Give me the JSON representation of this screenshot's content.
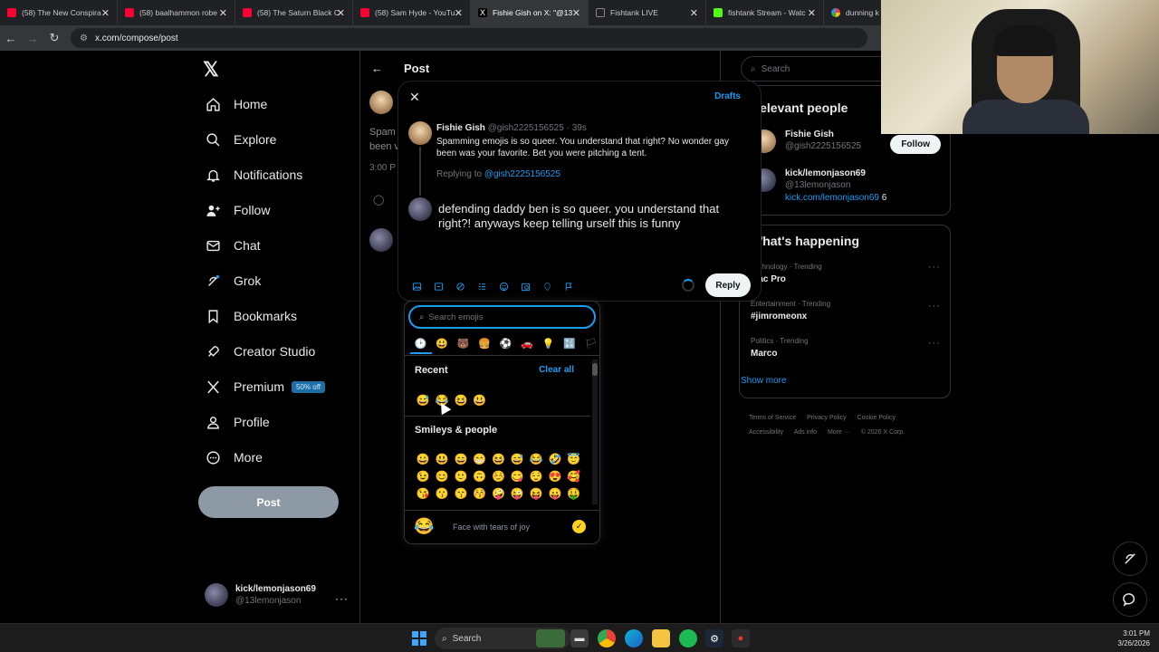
{
  "browser": {
    "tabs": [
      {
        "title": "(58) The New Conspira",
        "icon": "youtube-icon"
      },
      {
        "title": "(58) baalhammon robe",
        "icon": "youtube-icon"
      },
      {
        "title": "(58) The Saturn Black C",
        "icon": "youtube-icon"
      },
      {
        "title": "(58) Sam Hyde - YouTu",
        "icon": "youtube-icon"
      },
      {
        "title": "Fishie Gish on X: \"@13",
        "icon": "x-icon"
      },
      {
        "title": "Fishtank LIVE",
        "icon": "fishtank-icon"
      },
      {
        "title": "fishtank Stream - Watc",
        "icon": "kick-icon"
      },
      {
        "title": "dunning k",
        "icon": "google-icon"
      }
    ],
    "url": "x.com/compose/post"
  },
  "sidebar": {
    "logo": "𝕏",
    "items": [
      {
        "label": "Home",
        "icon": "home-icon"
      },
      {
        "label": "Explore",
        "icon": "search-icon"
      },
      {
        "label": "Notifications",
        "icon": "bell-icon"
      },
      {
        "label": "Follow",
        "icon": "person-add-icon"
      },
      {
        "label": "Chat",
        "icon": "mail-icon"
      },
      {
        "label": "Grok",
        "icon": "grok-icon"
      },
      {
        "label": "Bookmarks",
        "icon": "bookmark-icon"
      },
      {
        "label": "Creator Studio",
        "icon": "rocket-icon"
      },
      {
        "label": "Premium",
        "icon": "x-icon"
      },
      {
        "label": "Profile",
        "icon": "person-icon"
      },
      {
        "label": "More",
        "icon": "more-circle-icon"
      }
    ],
    "premium_badge": "50% off",
    "post_button": "Post",
    "account": {
      "name": "kick/lemonjason69",
      "handle": "@13lemonjason"
    }
  },
  "center": {
    "title": "Post",
    "bg_text": "Spam been v",
    "bg_time": "3:00 P"
  },
  "modal": {
    "close": "✕",
    "drafts": "Drafts",
    "original": {
      "name": "Fishie Gish",
      "handle": "@gish2225156525",
      "time": "· 39s",
      "text": "Spamming emojis is so queer. You understand that right? No wonder gay been was your favorite. Bet you were pitching a tent."
    },
    "replying_prefix": "Replying to",
    "replying_handle": "@gish2225156525",
    "reply_text": "defending daddy ben is so queer. you understand that right?! anyways keep telling urself this is funny",
    "reply_button": "Reply"
  },
  "emoji_picker": {
    "search_placeholder": "Search emojis",
    "categories": [
      "🕑",
      "😃",
      "🐻",
      "🍔",
      "⚽",
      "🚗",
      "💡",
      "🔣",
      "🏳"
    ],
    "recent_title": "Recent",
    "clear_all": "Clear all",
    "recent": [
      "😅",
      "😂",
      "😆",
      "😃"
    ],
    "smileys_title": "Smileys & people",
    "smileys_rows": [
      [
        "😀",
        "😃",
        "😄",
        "😁",
        "😆",
        "😅",
        "😂",
        "🤣",
        "😇"
      ],
      [
        "😉",
        "😊",
        "🙂",
        "🙃",
        "☺️",
        "😋",
        "😌",
        "😍",
        "🥰"
      ],
      [
        "😘",
        "😗",
        "😙",
        "😚",
        "🤪",
        "😜",
        "😝",
        "😛",
        "🤑"
      ]
    ],
    "footer_emoji": "😂",
    "footer_label": "Face with tears of joy",
    "footer_check": "✓"
  },
  "right": {
    "search_placeholder": "Search",
    "relevant_title": "Relevant people",
    "people": [
      {
        "name": "Fishie Gish",
        "handle": "@gish2225156525",
        "link": ""
      },
      {
        "name": "kick/lemonjason69",
        "handle": "@13lemonjason",
        "link": "kick.com/lemonjason69",
        "link_suffix": "6"
      }
    ],
    "follow_button": "Follow",
    "happening_title": "What's happening",
    "trends": [
      {
        "category": "Technology · Trending",
        "name": "Mac Pro"
      },
      {
        "category": "Entertainment · Trending",
        "name": "#jimromeonx"
      },
      {
        "category": "Politics · Trending",
        "name": "Marco"
      }
    ],
    "show_more": "Show more",
    "footer_links": [
      "Terms of Service",
      "Privacy Policy",
      "Cookie Policy",
      "Accessibility",
      "Ads info",
      "More ···",
      "© 2026 X Corp."
    ]
  },
  "taskbar": {
    "search": "Search",
    "time": "3:01 PM",
    "date": "3/26/2026"
  }
}
